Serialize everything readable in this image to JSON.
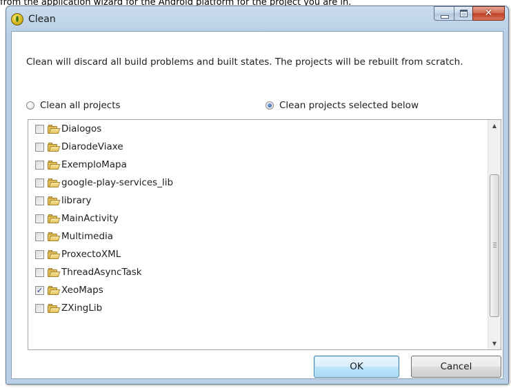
{
  "page_text": "from the application wizard for the Android platform for the project you are in.",
  "window": {
    "title": "Clean",
    "controls": {
      "minimize_icon": "minimize-icon",
      "maximize_icon": "maximize-icon",
      "close_glyph": "✕"
    }
  },
  "message": "Clean will discard all build problems and built states.  The projects will be rebuilt from scratch.",
  "options": {
    "clean_all": {
      "label": "Clean all projects",
      "selected": false
    },
    "clean_selected": {
      "label": "Clean projects selected below",
      "selected": true
    }
  },
  "projects": [
    {
      "name": "Dialogos",
      "checked": false
    },
    {
      "name": "DiarodeViaxe",
      "checked": false
    },
    {
      "name": "ExemploMapa",
      "checked": false
    },
    {
      "name": "google-play-services_lib",
      "checked": false
    },
    {
      "name": "library",
      "checked": false
    },
    {
      "name": "MainActivity",
      "checked": false
    },
    {
      "name": "Multimedia",
      "checked": false
    },
    {
      "name": "ProxectoXML",
      "checked": false
    },
    {
      "name": "ThreadAsyncTask",
      "checked": false
    },
    {
      "name": "XeoMaps",
      "checked": true
    },
    {
      "name": "ZXingLib",
      "checked": false
    }
  ],
  "checkmark": "✓",
  "scroll_arrows": {
    "up": "▲",
    "down": "▼"
  },
  "buttons": {
    "ok": "OK",
    "cancel": "Cancel"
  },
  "colors": {
    "title_bar": "#c9dcee",
    "close_button": "#c9482a",
    "default_button_border": "#3c7fb1"
  }
}
